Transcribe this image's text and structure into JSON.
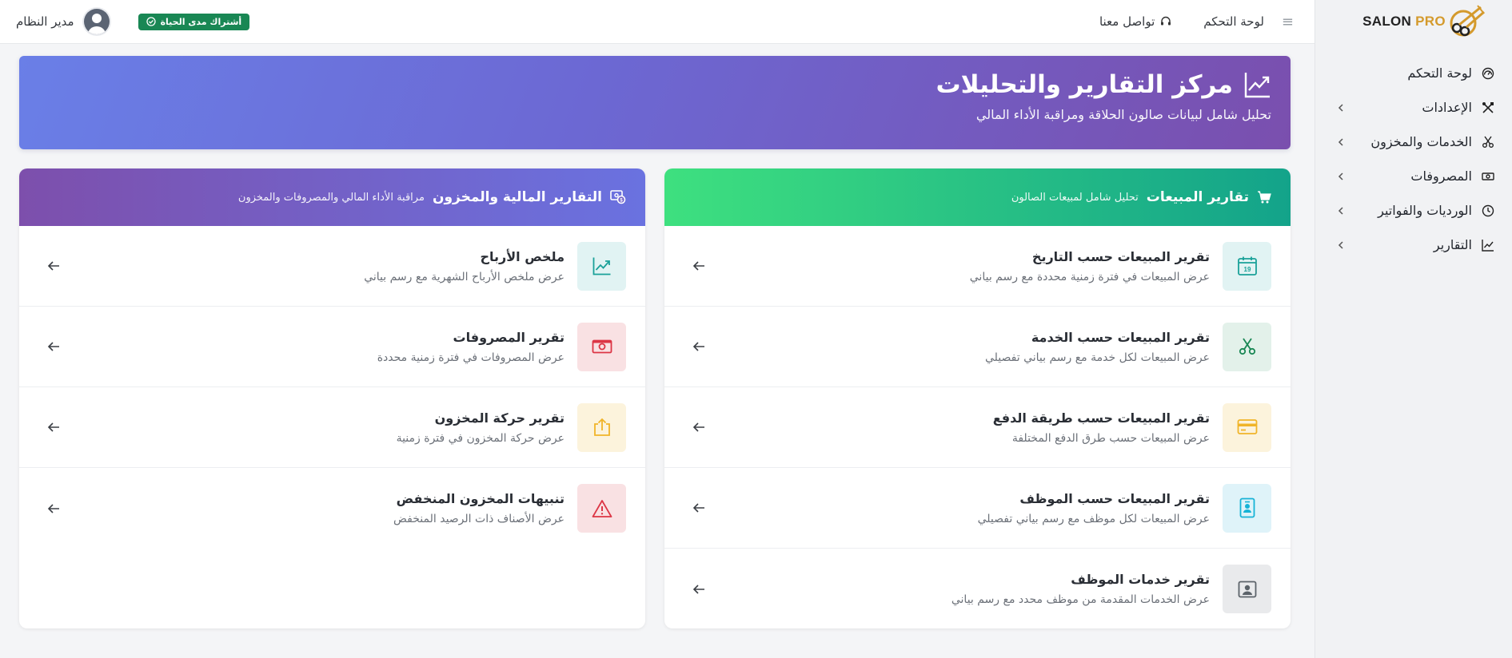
{
  "brand": {
    "name_salon": "SALON",
    "name_pro": "PRO"
  },
  "sidebar": {
    "items": [
      {
        "label": "لوحة التحكم",
        "icon": "dashboard-gauge-icon",
        "has_chevron": false
      },
      {
        "label": "الإعدادات",
        "icon": "tools-icon",
        "has_chevron": true
      },
      {
        "label": "الخدمات والمخزون",
        "icon": "scissors-icon",
        "has_chevron": true
      },
      {
        "label": "المصروفات",
        "icon": "cash-icon",
        "has_chevron": true
      },
      {
        "label": "الورديات والفواتير",
        "icon": "clock-icon",
        "has_chevron": true
      },
      {
        "label": "التقارير",
        "icon": "line-chart-icon",
        "has_chevron": true
      }
    ]
  },
  "topbar": {
    "menu_icon": "hamburger-icon",
    "dashboard_link": "لوحة التحكم",
    "contact_link": "تواصل معنا",
    "subscription_badge": "أشتراك مدى الحياة",
    "user_name": "مدير النظام"
  },
  "hero": {
    "title": "مركز التقارير والتحليلات",
    "subtitle": "تحليل شامل لبيانات صالون الحلاقة ومراقبة الأداء المالي"
  },
  "sales_card": {
    "title": "تقارير المبيعات",
    "subtitle": "تحليل شامل لمبيعات الصالون",
    "rows": [
      {
        "title": "تقرير المبيعات حسب التاريخ",
        "desc": "عرض المبيعات في فترة زمنية محددة مع رسم بياني",
        "icon": "calendar-icon",
        "icon_text": "19",
        "color": "#1aa199"
      },
      {
        "title": "تقرير المبيعات حسب الخدمة",
        "desc": "عرض المبيعات لكل خدمة مع رسم بياني تفصيلي",
        "icon": "scissors-icon",
        "color": "#198754"
      },
      {
        "title": "تقرير المبيعات حسب طريقة الدفع",
        "desc": "عرض المبيعات حسب طرق الدفع المختلفة",
        "icon": "credit-card-icon",
        "color": "#f0b429"
      },
      {
        "title": "تقرير المبيعات حسب الموظف",
        "desc": "عرض المبيعات لكل موظف مع رسم بياني تفصيلي",
        "icon": "id-badge-icon",
        "color": "#17b3d6"
      },
      {
        "title": "تقرير خدمات الموظف",
        "desc": "عرض الخدمات المقدمة من موظف محدد مع رسم بياني",
        "icon": "person-square-icon",
        "color": "#5c636a"
      }
    ]
  },
  "finance_card": {
    "title": "التقارير المالية والمخزون",
    "subtitle": "مراقبة الأداء المالي والمصروفات والمخزون",
    "rows": [
      {
        "title": "ملخص الأرباح",
        "desc": "عرض ملخص الأرباح الشهرية مع رسم بياني",
        "icon": "graph-up-icon",
        "color": "#1aa199"
      },
      {
        "title": "تقرير المصروفات",
        "desc": "عرض المصروفات في فترة زمنية محددة",
        "icon": "cash-icon",
        "color": "#dc3545"
      },
      {
        "title": "تقرير حركة المخزون",
        "desc": "عرض حركة المخزون في فترة زمنية",
        "icon": "box-arrow-up-icon",
        "color": "#f0b429"
      },
      {
        "title": "تنبيهات المخزون المنخفض",
        "desc": "عرض الأصناف ذات الرصيد المنخفض",
        "icon": "warning-triangle-icon",
        "color": "#dc3545"
      }
    ]
  },
  "colors": {
    "hero_gradient": [
      "#6a7fe7",
      "#7a4fae"
    ],
    "sales_header_gradient": [
      "#3ee07f",
      "#13a38a"
    ],
    "finance_header_gradient": [
      "#7d4fac",
      "#6a72e0"
    ],
    "badge": "#198754"
  }
}
